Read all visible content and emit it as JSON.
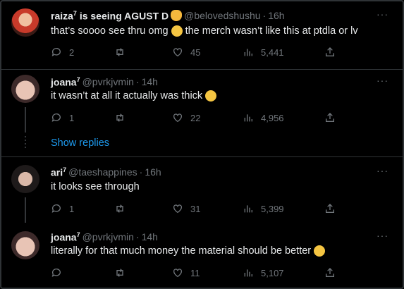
{
  "tweets": [
    {
      "name": "raiza",
      "sup": "7",
      "name_suffix": " is seeing AGUST D",
      "handle": "@belovedshushu",
      "dot": "·",
      "time": "16h",
      "text": "that’s soooo see thru omg",
      "text2": "the merch wasn’t like this at ptdla or lv",
      "replies": "2",
      "retweets": "",
      "likes": "45",
      "views": "5,441"
    },
    {
      "name": "joana",
      "sup": "7",
      "handle": "@pvrkjvmin",
      "dot": "·",
      "time": "14h",
      "text": "it wasn’t at all it actually was thick",
      "replies": "1",
      "retweets": "",
      "likes": "22",
      "views": "4,956"
    },
    {
      "name": "ari",
      "sup": "7",
      "handle": "@taeshappines",
      "dot": "·",
      "time": "16h",
      "text": "it looks see through",
      "replies": "1",
      "retweets": "",
      "likes": "31",
      "views": "5,399"
    },
    {
      "name": "joana",
      "sup": "7",
      "handle": "@pvrkjvmin",
      "dot": "·",
      "time": "14h",
      "text": "literally for that much money the material should be better",
      "replies": "",
      "retweets": "",
      "likes": "11",
      "views": "5,107"
    }
  ],
  "show_replies": "Show replies",
  "more_label": "···",
  "colors": {
    "background": "#000000",
    "text": "#e7e9ea",
    "muted": "#71767b",
    "link": "#1d9bf0"
  },
  "icons": [
    "reply-icon",
    "retweet-icon",
    "like-icon",
    "views-icon",
    "share-icon",
    "more-icon"
  ]
}
